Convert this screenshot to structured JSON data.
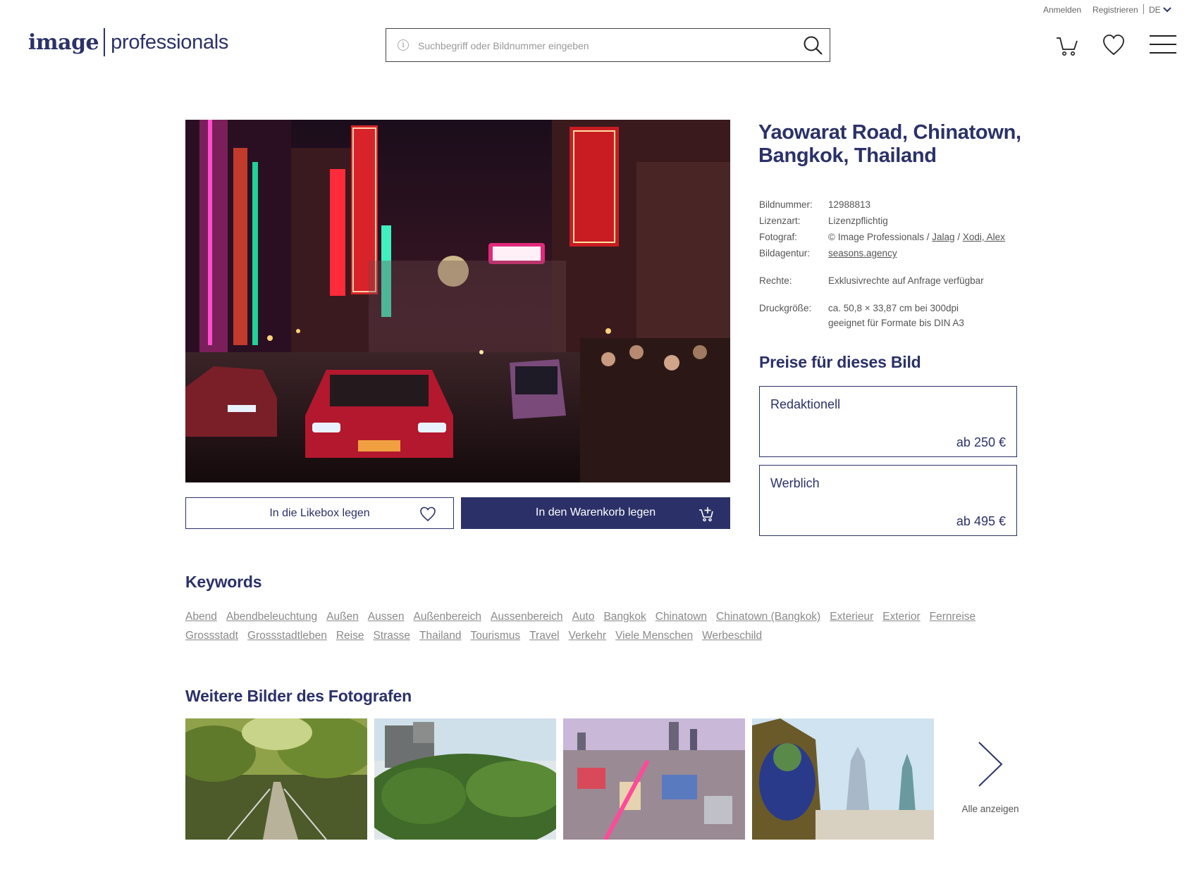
{
  "topbar": {
    "login": "Anmelden",
    "register": "Registrieren",
    "language": "DE"
  },
  "logo": {
    "part1": "image",
    "part2": "professionals"
  },
  "search": {
    "placeholder": "Suchbegriff oder Bildnummer eingeben",
    "value": "",
    "info_icon": "info-icon",
    "button_icon": "search-icon"
  },
  "nav": {
    "cart_icon": "cart-icon",
    "likebox_icon": "heart-icon",
    "menu_icon": "hamburger-menu-icon"
  },
  "image": {
    "alt": "Yaowarat Road, Chinatown, Bangkok, Thailand"
  },
  "actions": {
    "likebox_label": "In die Likebox legen",
    "cart_label": "In den Warenkorb legen"
  },
  "details": {
    "title": "Yaowarat Road, Chinatown, Bangkok, Thailand",
    "bildnummer_label": "Bildnummer:",
    "bildnummer": "12988813",
    "lizenzart_label": "Lizenzart:",
    "lizenzart": "Lizenzpflichtig",
    "fotograf_label": "Fotograf:",
    "fotograf_prefix": "© Image Professionals /",
    "fotograf_link1": "Jalag",
    "fotograf_sep": "/",
    "fotograf_link2": "Xodi, Alex",
    "bildagentur_label": "Bildagentur:",
    "bildagentur": "seasons.agency",
    "rechte_label": "Rechte:",
    "rechte": "Exklusivrechte auf Anfrage verfügbar",
    "druck_label": "Druckgröße:",
    "druck_line1": "ca. 50,8 × 33,87 cm bei 300dpi",
    "druck_line2": "geeignet für Formate bis DIN A3"
  },
  "prices": {
    "heading": "Preise für dieses Bild",
    "items": [
      {
        "name": "Redaktionell",
        "price": "ab 250 €"
      },
      {
        "name": "Werblich",
        "price": "ab 495 €"
      }
    ]
  },
  "keywords": {
    "heading": "Keywords",
    "row1": [
      "Abend",
      "Abendbeleuchtung",
      "Außen",
      "Aussen",
      "Außenbereich",
      "Aussenbereich",
      "Auto",
      "Bangkok",
      "Chinatown",
      "Chinatown (Bangkok)",
      "Exterieur",
      "Exterior",
      "Fernreise"
    ],
    "row2": [
      "Grossstadt",
      "Grossstadtleben",
      "Reise",
      "Strasse",
      "Thailand",
      "Tourismus",
      "Travel",
      "Verkehr",
      "Viele Menschen",
      "Werbeschild"
    ]
  },
  "more": {
    "heading": "Weitere Bilder des Fotografen",
    "show_all": "Alle anzeigen"
  },
  "colors": {
    "brand": "#2b3168",
    "keyword": "#8a8a8a",
    "text": "#555555"
  }
}
